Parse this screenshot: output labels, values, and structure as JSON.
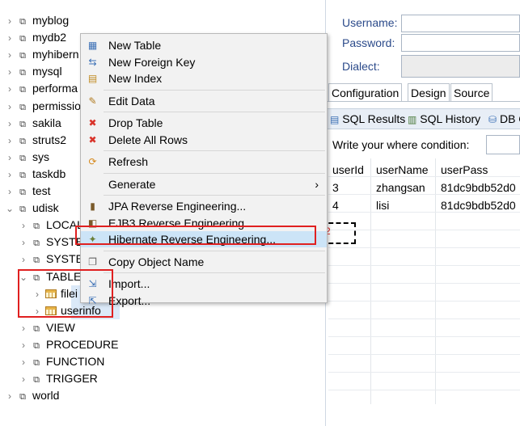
{
  "tree": {
    "items": [
      {
        "label": "myblog",
        "indent": 0,
        "chevron": "›",
        "icon": "db"
      },
      {
        "label": "mydb2",
        "indent": 0,
        "chevron": "›",
        "icon": "db"
      },
      {
        "label": "myhibern",
        "indent": 0,
        "chevron": "›",
        "icon": "db"
      },
      {
        "label": "mysql",
        "indent": 0,
        "chevron": "›",
        "icon": "db"
      },
      {
        "label": "performa",
        "indent": 0,
        "chevron": "›",
        "icon": "db"
      },
      {
        "label": "permissio",
        "indent": 0,
        "chevron": "›",
        "icon": "db"
      },
      {
        "label": "sakila",
        "indent": 0,
        "chevron": "›",
        "icon": "db"
      },
      {
        "label": "struts2",
        "indent": 0,
        "chevron": "›",
        "icon": "db"
      },
      {
        "label": "sys",
        "indent": 0,
        "chevron": "›",
        "icon": "db"
      },
      {
        "label": "taskdb",
        "indent": 0,
        "chevron": "›",
        "icon": "db"
      },
      {
        "label": "test",
        "indent": 0,
        "chevron": "›",
        "icon": "db"
      },
      {
        "label": "udisk",
        "indent": 0,
        "chevron": "⌄",
        "icon": "db"
      },
      {
        "label": "LOCAL",
        "indent": 1,
        "chevron": "›",
        "icon": "db"
      },
      {
        "label": "SYSTE",
        "indent": 1,
        "chevron": "›",
        "icon": "db"
      },
      {
        "label": "SYSTE",
        "indent": 1,
        "chevron": "›",
        "icon": "db"
      },
      {
        "label": "TABLE",
        "indent": 1,
        "chevron": "⌄",
        "icon": "db"
      },
      {
        "label": "filei",
        "indent": 2,
        "chevron": "›",
        "icon": "table"
      },
      {
        "label": "userinfo",
        "indent": 2,
        "chevron": "›",
        "icon": "table"
      },
      {
        "label": "VIEW",
        "indent": 1,
        "chevron": "›",
        "icon": "db"
      },
      {
        "label": "PROCEDURE",
        "indent": 1,
        "chevron": "›",
        "icon": "db"
      },
      {
        "label": "FUNCTION",
        "indent": 1,
        "chevron": "›",
        "icon": "db"
      },
      {
        "label": "TRIGGER",
        "indent": 1,
        "chevron": "›",
        "icon": "db"
      },
      {
        "label": "world",
        "indent": 0,
        "chevron": "›",
        "icon": "db"
      }
    ]
  },
  "menu": {
    "items": [
      {
        "label": "New Table",
        "icon": "new-table-icon",
        "glyph": "▦",
        "color": "#3a6fb5"
      },
      {
        "label": "New Foreign Key",
        "icon": "foreign-key-icon",
        "glyph": "⇆",
        "color": "#3a6fb5"
      },
      {
        "label": "New Index",
        "icon": "index-icon",
        "glyph": "▤",
        "color": "#c08a20"
      },
      {
        "sep": true
      },
      {
        "label": "Edit Data",
        "icon": "edit-data-icon",
        "glyph": "✎",
        "color": "#b07a1e"
      },
      {
        "sep": true
      },
      {
        "label": "Drop Table",
        "icon": "drop-table-icon",
        "glyph": "✖",
        "color": "#d9342b"
      },
      {
        "label": "Delete All Rows",
        "icon": "delete-rows-icon",
        "glyph": "✖",
        "color": "#d9342b"
      },
      {
        "sep": true
      },
      {
        "label": "Refresh",
        "icon": "refresh-icon",
        "glyph": "⟳",
        "color": "#d6891c"
      },
      {
        "sep": true
      },
      {
        "label": "Generate",
        "icon": "",
        "glyph": "",
        "color": "#000",
        "submenu": "›"
      },
      {
        "sep": true
      },
      {
        "label": "JPA Reverse Engineering...",
        "icon": "jpa-icon",
        "glyph": "▮",
        "color": "#7a5a2a"
      },
      {
        "label": "EJB3 Reverse Engineering...",
        "icon": "ejb3-icon",
        "glyph": "◧",
        "color": "#7a5a2a"
      },
      {
        "label": "Hibernate Reverse Engineering...",
        "icon": "hibernate-icon",
        "glyph": "✦",
        "color": "#6b7f3a",
        "highlight": true
      },
      {
        "sep": true
      },
      {
        "label": "Copy Object Name",
        "icon": "copy-icon",
        "glyph": "❐",
        "color": "#666"
      },
      {
        "sep": true
      },
      {
        "label": "Import...",
        "icon": "import-icon",
        "glyph": "⇲",
        "color": "#3a6fb5"
      },
      {
        "label": "Export...",
        "icon": "export-icon",
        "glyph": "⇱",
        "color": "#3a6fb5"
      }
    ]
  },
  "connection": {
    "username_label": "Username:",
    "password_label": "Password:",
    "dialect_label": "Dialect:"
  },
  "editor_tabs": [
    "Configuration",
    "Design",
    "Source"
  ],
  "views": {
    "sql_results": "SQL Results",
    "sql_history": "SQL History",
    "db": "DB C"
  },
  "where_label": "Write your where condition:",
  "results": {
    "columns": [
      "userId",
      "userName",
      "userPass"
    ],
    "rows": [
      [
        "3",
        "zhangsan",
        "81dc9bdb52d0"
      ],
      [
        "4",
        "lisi",
        "81dc9bdb52d0"
      ]
    ],
    "new_row_marker": "2"
  },
  "colors": {
    "annotation": "#e02020",
    "highlight": "#cce4f7",
    "selection": "#dbe9f8"
  }
}
